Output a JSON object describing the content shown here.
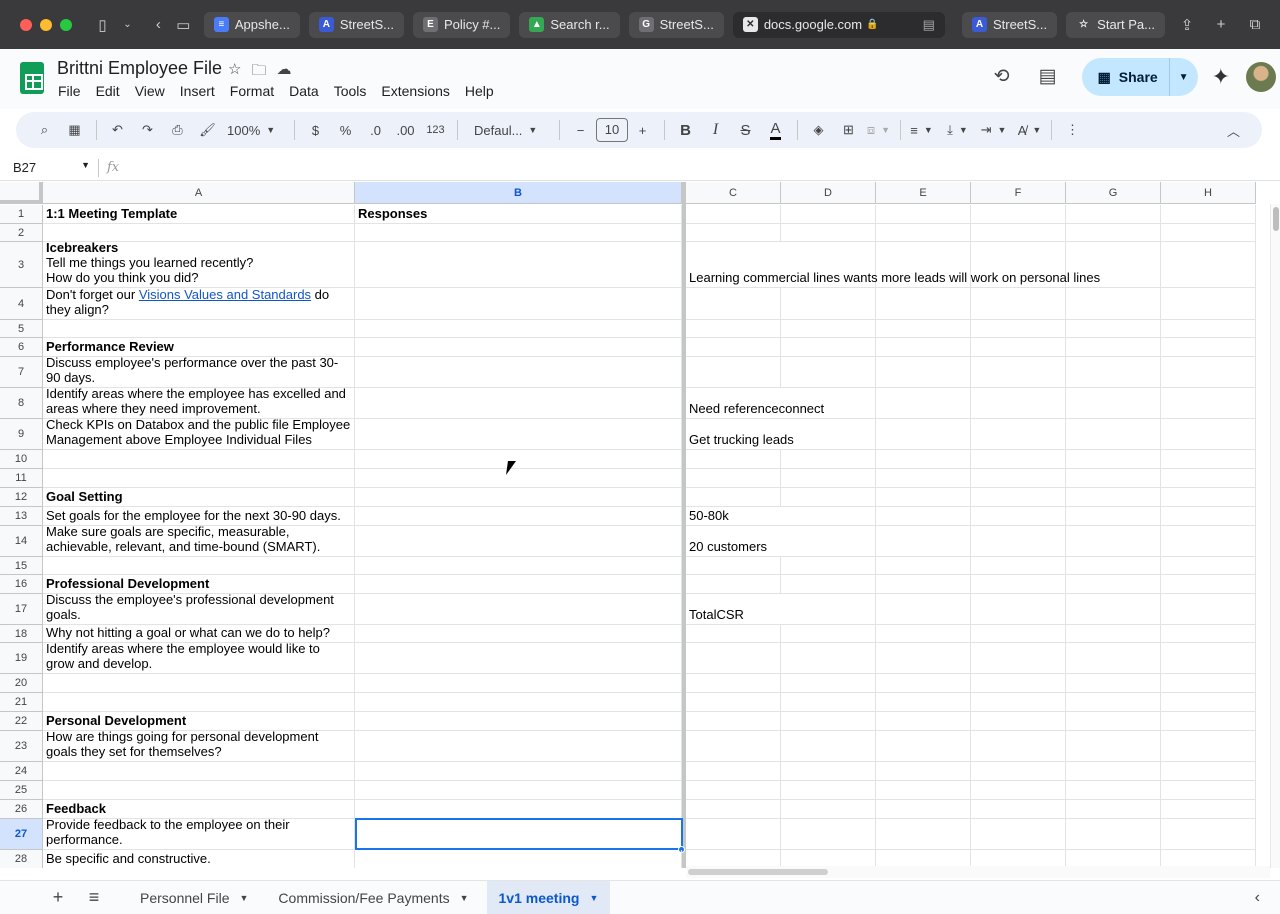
{
  "browser": {
    "tabs": [
      {
        "label": "Appshe...",
        "fav_color": "#4a7cf7",
        "fav": "≡"
      },
      {
        "label": "StreetS...",
        "fav_color": "#3b5bd6",
        "fav": "A"
      },
      {
        "label": "Policy #...",
        "fav_color": "#6e6e73",
        "fav": "E"
      },
      {
        "label": "Search r...",
        "fav_color": "#34a853",
        "fav": "▲"
      },
      {
        "label": "StreetS...",
        "fav_color": "#6e6e73",
        "fav": "G"
      }
    ],
    "active_tab": {
      "label": "docs.google.com"
    },
    "right_tabs": [
      {
        "label": "StreetS...",
        "fav_color": "#3b5bd6",
        "fav": "A"
      },
      {
        "label": "Start Pa...",
        "fav_color": "transparent",
        "fav": "☆"
      }
    ]
  },
  "doc": {
    "title": "Brittni Employee File",
    "menu": [
      "File",
      "Edit",
      "View",
      "Insert",
      "Format",
      "Data",
      "Tools",
      "Extensions",
      "Help"
    ],
    "share_label": "Share"
  },
  "toolbar": {
    "zoom": "100%",
    "currency": "$",
    "percent": "%",
    "dec_decrease": ".0",
    "dec_increase": ".00",
    "number_format": "123",
    "font": "Defaul...",
    "font_size": "10",
    "bold": "B",
    "italic": "I",
    "strike": "S",
    "text_color": "A"
  },
  "formula_bar": {
    "name_box": "B27",
    "fx": "fx",
    "content": ""
  },
  "columns": [
    "A",
    "B",
    "C",
    "D",
    "E",
    "F",
    "G",
    "H"
  ],
  "selected_column": "B",
  "selected_row": "27",
  "rows": [
    {
      "n": "1",
      "a": "1:1 Meeting Template",
      "a_bold": true,
      "b": "Responses",
      "c": ""
    },
    {
      "n": "2",
      "a": "",
      "b": "",
      "c": ""
    },
    {
      "n": "3",
      "a_head": "Icebreakers",
      "a": "Tell me things you learned recently?\nHow do you think you did?",
      "b": "",
      "c": "Learning commercial lines wants more leads  will work on personal lines"
    },
    {
      "n": "4",
      "a_pre": "Don't forget our ",
      "a_link": "Visions Values and Standards",
      "a_post": " do they align?",
      "b": "",
      "c": ""
    },
    {
      "n": "5",
      "a": "",
      "b": "",
      "c": ""
    },
    {
      "n": "6",
      "a": "Performance Review",
      "a_bold": true,
      "b": "",
      "c": ""
    },
    {
      "n": "7",
      "a": "Discuss employee's performance over the past 30-90 days.",
      "b": "",
      "c": ""
    },
    {
      "n": "8",
      "a": "Identify areas where the employee has excelled and areas where they need improvement.",
      "b": "",
      "c": "Need referenceconnect"
    },
    {
      "n": "9",
      "a": "Check KPIs on Databox and the public file Employee Management above Employee Individual Files",
      "b": "",
      "c": "Get trucking leads"
    },
    {
      "n": "10",
      "a": "",
      "b": "",
      "c": ""
    },
    {
      "n": "11",
      "a": "",
      "b": "",
      "c": ""
    },
    {
      "n": "12",
      "a": "Goal Setting",
      "a_bold": true,
      "b": "",
      "c": ""
    },
    {
      "n": "13",
      "a": "Set goals for the employee for the next 30-90 days.",
      "b": "",
      "c": "50-80k"
    },
    {
      "n": "14",
      "a": "Make sure goals are specific, measurable, achievable, relevant, and time-bound (SMART).",
      "b": "",
      "c": "20 customers"
    },
    {
      "n": "15",
      "a": "",
      "b": "",
      "c": ""
    },
    {
      "n": "16",
      "a": "Professional Development",
      "a_bold": true,
      "b": "",
      "c": ""
    },
    {
      "n": "17",
      "a": "Discuss the employee's professional development goals.",
      "b": "",
      "c": "TotalCSR"
    },
    {
      "n": "18",
      "a": "Why not hitting a goal or what can we do to help?",
      "b": "",
      "c": ""
    },
    {
      "n": "19",
      "a": "Identify areas where the employee would like to grow and develop.",
      "b": "",
      "c": ""
    },
    {
      "n": "20",
      "a": "",
      "b": "",
      "c": ""
    },
    {
      "n": "21",
      "a": "",
      "b": "",
      "c": ""
    },
    {
      "n": "22",
      "a": "Personal Development",
      "a_bold": true,
      "b": "",
      "c": ""
    },
    {
      "n": "23",
      "a": "How are things going for personal development goals they set for themselves?",
      "b": "",
      "c": ""
    },
    {
      "n": "24",
      "a": "",
      "b": "",
      "c": ""
    },
    {
      "n": "25",
      "a": "",
      "b": "",
      "c": ""
    },
    {
      "n": "26",
      "a": "Feedback",
      "a_bold": true,
      "b": "",
      "c": ""
    },
    {
      "n": "27",
      "a": "Provide feedback to the employee on their performance.",
      "b": "",
      "c": ""
    },
    {
      "n": "28",
      "a": "Be specific and constructive.",
      "b": "",
      "c": ""
    }
  ],
  "sheet_tabs": [
    {
      "label": "Personnel File",
      "active": false
    },
    {
      "label": "Commission/Fee Payments",
      "active": false
    },
    {
      "label": "1v1 meeting",
      "active": true
    }
  ]
}
